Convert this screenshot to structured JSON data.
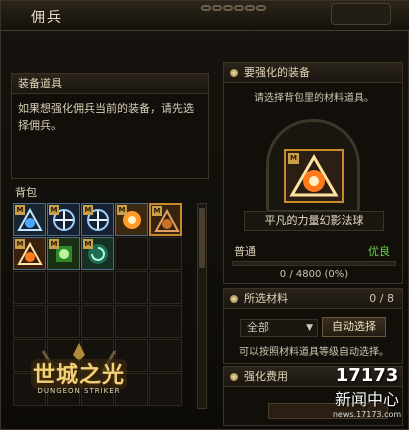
{
  "window": {
    "title": "佣兵"
  },
  "equip_section": {
    "title": "装备道具",
    "description": "如果想强化佣兵当前的装备，请先选择佣兵。"
  },
  "bag": {
    "title": "背包",
    "badge": "M",
    "slots": [
      {
        "icon": "blue-triangle-orb-icon",
        "color": "#2f7fd1"
      },
      {
        "icon": "blue-cross-orb-icon",
        "color": "#2a6fd6"
      },
      {
        "icon": "blue-cross-orb-icon",
        "color": "#2a6fd6"
      },
      {
        "icon": "orange-starburst-orb-icon",
        "color": "#e08a22"
      },
      {
        "icon": "orange-triangle-orb-icon",
        "color": "#c9712a"
      },
      {
        "icon": "fire-triangle-orb-icon",
        "color": "#e36a1f"
      },
      {
        "icon": "green-square-orb-icon",
        "color": "#3fae3a"
      },
      {
        "icon": "green-spiral-orb-icon",
        "color": "#2fb88a"
      }
    ]
  },
  "logo": {
    "title": "世城之光",
    "subtitle": "DUNGEON STRIKER"
  },
  "upgrade_section": {
    "title": "要强化的装备",
    "hint": "请选择背包里的材料道具。",
    "item_name": "平凡的力量幻影法球",
    "grade_left": "普通",
    "grade_right": "优良",
    "progress_text": "0 / 4800 (0%)",
    "progress_value": 0,
    "badge": "M",
    "item_icon": "fire-triangle-orb-icon"
  },
  "materials_section": {
    "title": "所选材料",
    "count": "0 / 8",
    "filter_value": "全部",
    "auto_select_label": "自动选择",
    "hint": "可以按照材料道具等级自动选择。"
  },
  "cost_section": {
    "title": "强化费用"
  },
  "watermark": {
    "line1": "17173",
    "line2": "新闻中心",
    "line3": "news.17173.com"
  },
  "colors": {
    "accent": "#c98a2b",
    "grade_good": "#6bd14a",
    "panel_border": "#3b3326"
  }
}
